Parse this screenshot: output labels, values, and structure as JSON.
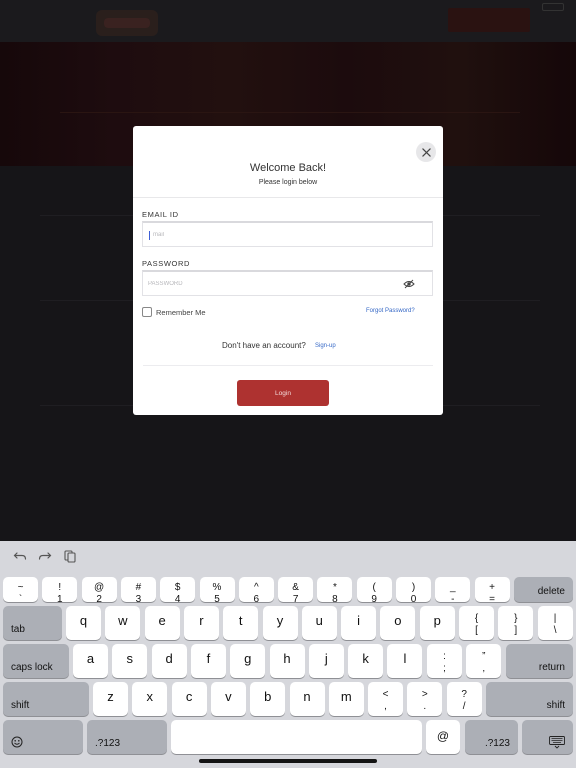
{
  "modal": {
    "title": "Welcome Back!",
    "subtitle": "Please login below",
    "email_label": "EMAIL ID",
    "email_placeholder": "mail",
    "password_label": "PASSWORD",
    "password_placeholder": "PASSWORD",
    "remember_label": "Remember Me",
    "forgot_link": "Forgot Password?",
    "signup_question": "Don't have an account?",
    "signup_link": "Sign-up",
    "login_button": "Login",
    "accent_color": "#ae3230",
    "link_color": "#3568c6"
  },
  "keyboard": {
    "number_row": [
      {
        "top": "~",
        "bottom": "`"
      },
      {
        "top": "!",
        "bottom": "1"
      },
      {
        "top": "@",
        "bottom": "2"
      },
      {
        "top": "#",
        "bottom": "3"
      },
      {
        "top": "$",
        "bottom": "4"
      },
      {
        "top": "%",
        "bottom": "5"
      },
      {
        "top": "^",
        "bottom": "6"
      },
      {
        "top": "&",
        "bottom": "7"
      },
      {
        "top": "*",
        "bottom": "8"
      },
      {
        "top": "(",
        "bottom": "9"
      },
      {
        "top": ")",
        "bottom": "0"
      },
      {
        "top": "_",
        "bottom": "-"
      },
      {
        "top": "+",
        "bottom": "="
      }
    ],
    "delete_label": "delete",
    "tab_label": "tab",
    "row_q": [
      "q",
      "w",
      "e",
      "r",
      "t",
      "y",
      "u",
      "i",
      "o",
      "p"
    ],
    "row_q_symbols": [
      {
        "top": "{",
        "bottom": "["
      },
      {
        "top": "}",
        "bottom": "]"
      },
      {
        "top": "|",
        "bottom": "\\"
      }
    ],
    "caps_label": "caps lock",
    "row_a": [
      "a",
      "s",
      "d",
      "f",
      "g",
      "h",
      "j",
      "k",
      "l"
    ],
    "row_a_symbols": [
      {
        "top": ":",
        "bottom": ";"
      },
      {
        "top": "”",
        "bottom": "‚"
      }
    ],
    "return_label": "return",
    "shift_label": "shift",
    "row_z": [
      "z",
      "x",
      "c",
      "v",
      "b",
      "n",
      "m"
    ],
    "row_z_symbols": [
      {
        "top": "<",
        "bottom": ","
      },
      {
        "top": ">",
        "bottom": "."
      },
      {
        "top": "?",
        "bottom": "/"
      }
    ],
    "numbers_label": ".?123",
    "at_label": "@",
    "emoji_icon": "emoji-icon",
    "hide_keyboard_icon": "keyboard-hide-icon"
  }
}
